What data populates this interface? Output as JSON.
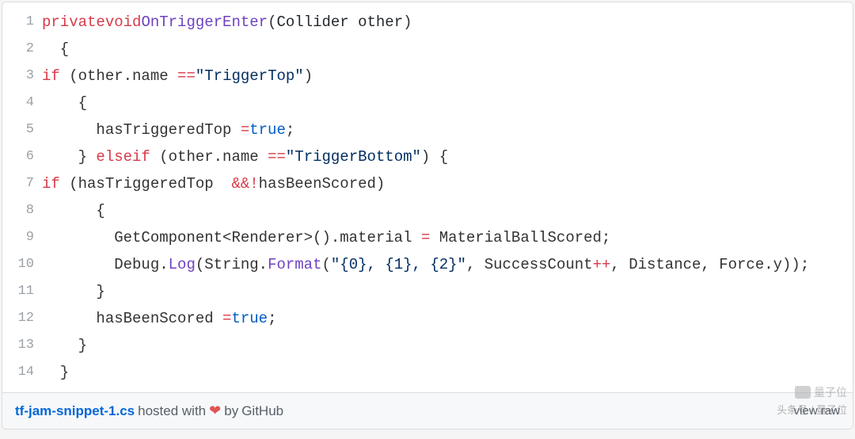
{
  "line_count": 14,
  "code_lines_html": [
    "  <span class='kw'>private</span> <span class='kw'>void</span> <span class='call'>OnTriggerEnter</span>(<span class='plain'>Collider other</span>)",
    "  {",
    "    <span class='kw'>if</span> (other.name <span class='op'>==</span> <span class='str'>\"TriggerTop\"</span>)",
    "    {",
    "      hasTriggeredTop <span class='op'>=</span> <span class='bool'>true</span>;",
    "    } <span class='kw'>else</span> <span class='kw'>if</span> (other.name <span class='op'>==</span> <span class='str'>\"TriggerBottom\"</span>) {",
    "      <span class='kw'>if</span> (hasTriggeredTop  <span class='op'>&amp;&amp;</span> <span class='op'>!</span>hasBeenScored)",
    "      {",
    "        GetComponent&lt;Renderer&gt;().material <span class='op'>=</span> MaterialBallScored;",
    "        Debug.<span class='call'>Log</span>(String.<span class='call'>Format</span>(<span class='str'>\"{0}, {1}, {2}\"</span>, SuccessCount<span class='op'>++</span>, Distance, Force.y));",
    "      }",
    "      hasBeenScored <span class='op'>=</span> <span class='bool'>true</span>;",
    "    }",
    "  }"
  ],
  "footer": {
    "filename": "tf-jam-snippet-1.cs",
    "hosted_with": " hosted with ",
    "by": " by ",
    "github": "GitHub",
    "view_raw": "view raw"
  },
  "watermark": {
    "top": "量子位",
    "bottom": "头条号 / 量子位"
  }
}
